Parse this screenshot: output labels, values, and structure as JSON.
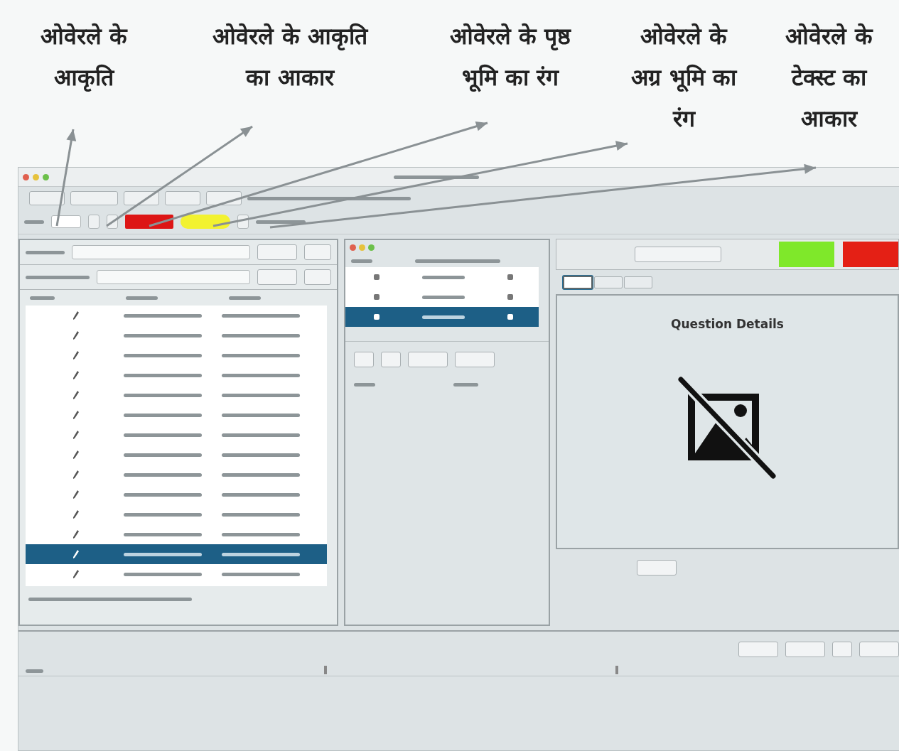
{
  "annotations": [
    {
      "text": "ओवेरले के आकृति"
    },
    {
      "text": "ओवेरले के आकृति का आकार"
    },
    {
      "text": "ओवेरले के पृष्ठ भूमि का रंग"
    },
    {
      "text": "ओवेरले के अग्र भूमि का रंग"
    },
    {
      "text": "ओवेरले के टेक्स्ट का आकार"
    }
  ],
  "toolbar": {
    "swatches": [
      {
        "color": "#dd1515"
      },
      {
        "color": "#f2f230"
      }
    ]
  },
  "file_table": {
    "rows": [
      {
        "selected": false
      },
      {
        "selected": false
      },
      {
        "selected": false
      },
      {
        "selected": false
      },
      {
        "selected": false
      },
      {
        "selected": false
      },
      {
        "selected": false
      },
      {
        "selected": false
      },
      {
        "selected": false
      },
      {
        "selected": false
      },
      {
        "selected": false
      },
      {
        "selected": false
      },
      {
        "selected": true
      },
      {
        "selected": false
      }
    ]
  },
  "question_list": {
    "rows": [
      {
        "selected": false
      },
      {
        "selected": false
      },
      {
        "selected": true
      }
    ]
  },
  "detail_panel": {
    "indicators": [
      {
        "color": "#7fe82a"
      },
      {
        "color": "#e42015"
      }
    ],
    "tabs": [
      {
        "selected": true
      },
      {
        "selected": false
      },
      {
        "selected": false
      }
    ],
    "title": "Question Details"
  }
}
